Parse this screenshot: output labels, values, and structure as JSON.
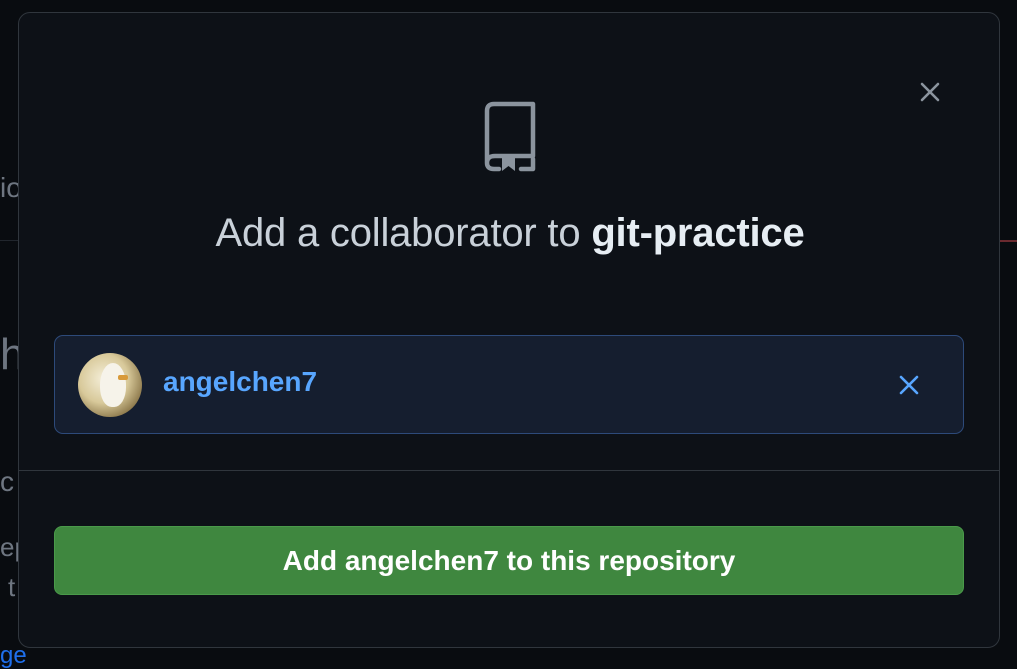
{
  "background": {
    "fragments": [
      "io",
      "h",
      "c",
      "ep",
      "t",
      "ge"
    ]
  },
  "modal": {
    "title_prefix": "Add a collaborator to",
    "repo_name": "git-practice",
    "icons": {
      "close": "close-icon",
      "repo": "repo-icon",
      "remove": "remove-icon"
    },
    "selected_user": {
      "username": "angelchen7"
    },
    "add_button_label": "Add angelchen7 to this repository"
  },
  "colors": {
    "modal_bg": "#0d1117",
    "link_blue": "#58a6ff",
    "button_green": "#3f873f",
    "selected_bg": "#151e2f"
  }
}
